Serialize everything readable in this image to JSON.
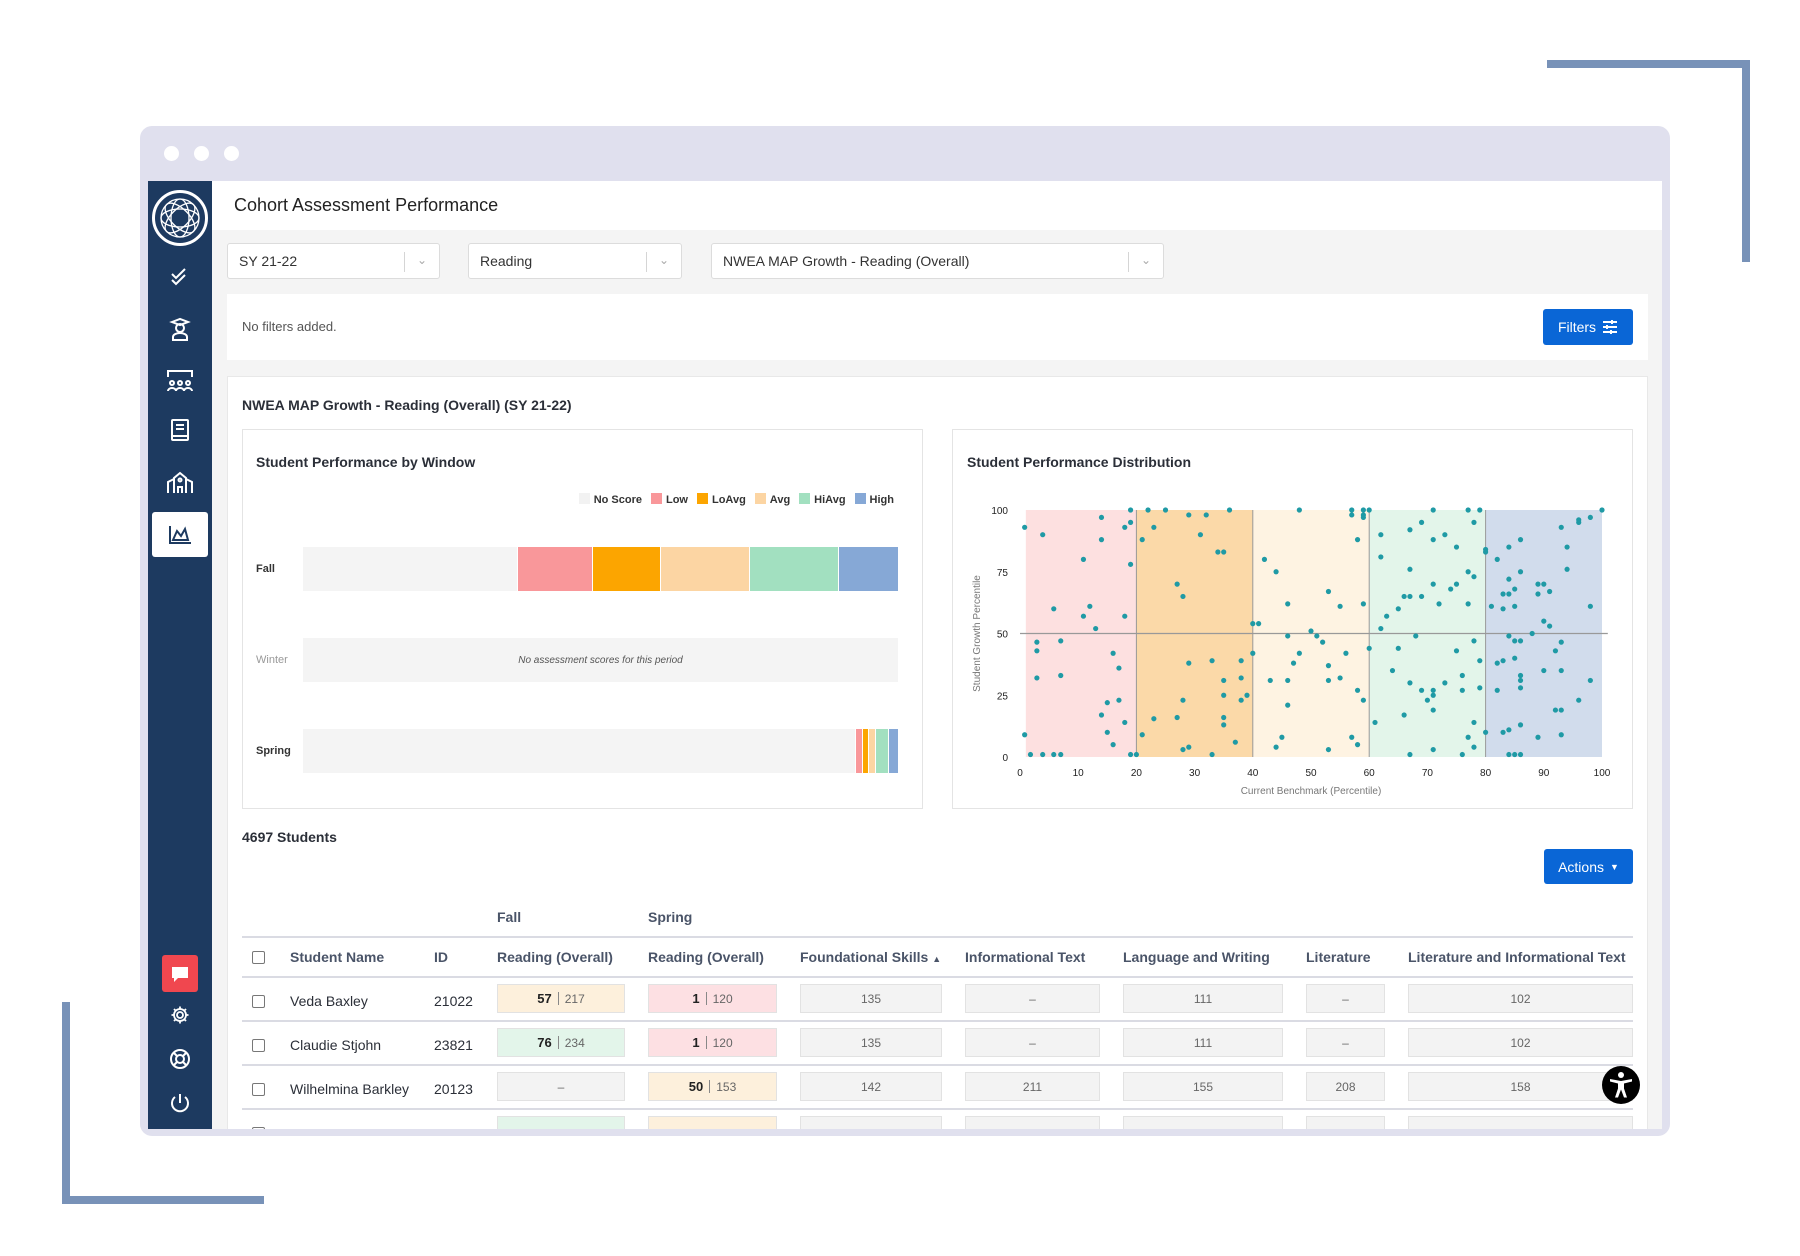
{
  "app": {
    "page_title": "Cohort Assessment Performance"
  },
  "selects": {
    "year": "SY 21-22",
    "subject": "Reading",
    "assessment": "NWEA MAP Growth - Reading (Overall)"
  },
  "filters": {
    "status": "No filters added.",
    "button": "Filters"
  },
  "section_title": "NWEA MAP Growth - Reading (Overall) (SY 21-22)",
  "colors": {
    "sidebar": "#1d3a60",
    "accent": "#0a66d6",
    "chat": "#f0474f",
    "dot": "#1f9aa5"
  },
  "sidebar": {
    "items": [
      {
        "icon": "checklist-icon"
      },
      {
        "icon": "student-icon"
      },
      {
        "icon": "classroom-icon"
      },
      {
        "icon": "book-icon"
      },
      {
        "icon": "school-icon"
      },
      {
        "icon": "chart-icon",
        "active": true
      }
    ],
    "bottom": [
      {
        "icon": "chat-icon"
      },
      {
        "icon": "gear-icon"
      },
      {
        "icon": "lifebuoy-icon"
      },
      {
        "icon": "power-icon"
      }
    ]
  },
  "chart_data": [
    {
      "type": "bar",
      "orientation": "horizontal-stacked",
      "title": "Student Performance by Window",
      "legend": [
        {
          "name": "No Score",
          "color": "#f2f2f2"
        },
        {
          "name": "Low",
          "color": "#f9979a"
        },
        {
          "name": "LoAvg",
          "color": "#fca500"
        },
        {
          "name": "Avg",
          "color": "#fcd5a3"
        },
        {
          "name": "HiAvg",
          "color": "#a2e0c0"
        },
        {
          "name": "High",
          "color": "#86a8d6"
        }
      ],
      "legend_position": "top-right",
      "categories": [
        "Fall",
        "Winter",
        "Spring"
      ],
      "values_percent": [
        [
          36,
          12.5,
          11.5,
          15,
          15,
          10
        ],
        null,
        [
          92.8,
          1.2,
          1.0,
          1.2,
          2.1,
          1.7
        ]
      ],
      "empty_message": "No assessment scores for this period"
    },
    {
      "type": "scatter",
      "title": "Student Performance Distribution",
      "xlabel": "Current Benchmark (Percentile)",
      "ylabel": "Student Growth Percentile",
      "xlim": [
        0,
        100
      ],
      "ylim": [
        0,
        100
      ],
      "xticks": [
        0,
        10,
        20,
        30,
        40,
        50,
        60,
        70,
        80,
        90,
        100
      ],
      "yticks": [
        0,
        25,
        50,
        75,
        100
      ],
      "bands": [
        {
          "from": 1,
          "to": 20,
          "color": "#fde0e0"
        },
        {
          "from": 20,
          "to": 40,
          "color": "#fbd9a8"
        },
        {
          "from": 40,
          "to": 60,
          "color": "#fef3e2"
        },
        {
          "from": 60,
          "to": 80,
          "color": "#e3f5ea"
        },
        {
          "from": 80,
          "to": 100,
          "color": "#d1dcec"
        }
      ],
      "reference_lines": {
        "x": [
          20,
          40,
          60,
          80
        ],
        "y": [
          50
        ]
      },
      "points": [
        [
          0.8,
          93
        ],
        [
          0.8,
          9
        ],
        [
          1.8,
          1
        ],
        [
          2.9,
          46.5
        ],
        [
          2.9,
          43
        ],
        [
          2.9,
          32
        ],
        [
          3.9,
          90
        ],
        [
          3.9,
          1
        ],
        [
          5.8,
          60
        ],
        [
          5.8,
          1
        ],
        [
          7,
          47
        ],
        [
          7,
          33
        ],
        [
          7,
          1
        ],
        [
          10.9,
          80
        ],
        [
          10.9,
          57
        ],
        [
          12,
          61
        ],
        [
          13,
          52
        ],
        [
          14,
          97
        ],
        [
          14,
          88
        ],
        [
          14,
          17
        ],
        [
          15,
          22
        ],
        [
          15,
          10
        ],
        [
          16,
          42
        ],
        [
          16,
          5
        ],
        [
          17,
          36
        ],
        [
          17,
          23
        ],
        [
          18,
          57
        ],
        [
          18,
          93
        ],
        [
          18,
          14
        ],
        [
          19,
          100
        ],
        [
          19,
          95
        ],
        [
          19,
          78
        ],
        [
          19,
          1
        ],
        [
          20,
          1
        ],
        [
          21,
          88
        ],
        [
          21,
          9
        ],
        [
          22,
          100
        ],
        [
          23,
          93
        ],
        [
          23,
          15.5
        ],
        [
          25,
          100
        ],
        [
          27,
          70
        ],
        [
          27,
          16
        ],
        [
          28,
          65
        ],
        [
          28,
          23
        ],
        [
          28,
          3
        ],
        [
          29,
          98
        ],
        [
          29,
          38
        ],
        [
          29,
          4
        ],
        [
          31,
          90
        ],
        [
          32,
          98
        ],
        [
          33,
          1
        ],
        [
          33,
          39
        ],
        [
          34,
          83
        ],
        [
          35,
          83
        ],
        [
          35,
          31
        ],
        [
          35,
          25
        ],
        [
          35,
          16
        ],
        [
          35,
          13
        ],
        [
          36,
          100
        ],
        [
          37,
          6
        ],
        [
          38,
          39
        ],
        [
          38,
          32
        ],
        [
          38,
          23
        ],
        [
          39,
          25
        ],
        [
          40,
          54
        ],
        [
          40,
          42
        ],
        [
          41,
          54
        ],
        [
          42,
          80
        ],
        [
          43,
          31
        ],
        [
          44,
          75
        ],
        [
          44,
          4
        ],
        [
          45,
          8
        ],
        [
          46,
          62
        ],
        [
          46,
          49
        ],
        [
          46,
          31
        ],
        [
          46,
          21
        ],
        [
          47,
          38
        ],
        [
          48,
          100
        ],
        [
          48,
          42
        ],
        [
          50,
          51
        ],
        [
          51,
          49
        ],
        [
          52,
          46.5
        ],
        [
          53,
          67
        ],
        [
          53,
          37
        ],
        [
          53,
          31
        ],
        [
          53,
          3
        ],
        [
          55,
          61
        ],
        [
          55,
          32
        ],
        [
          56,
          42
        ],
        [
          57,
          100
        ],
        [
          57,
          98
        ],
        [
          57,
          8
        ],
        [
          58,
          88
        ],
        [
          58,
          27
        ],
        [
          58,
          5
        ],
        [
          59,
          100
        ],
        [
          59,
          98
        ],
        [
          59,
          97
        ],
        [
          59,
          62
        ],
        [
          59,
          23
        ],
        [
          60,
          100
        ],
        [
          60,
          44
        ],
        [
          61,
          14
        ],
        [
          62,
          90
        ],
        [
          62,
          81
        ],
        [
          62,
          52
        ],
        [
          63,
          57
        ],
        [
          64,
          35
        ],
        [
          65,
          60
        ],
        [
          65,
          44
        ],
        [
          66,
          65
        ],
        [
          66,
          17
        ],
        [
          67,
          92
        ],
        [
          67,
          76
        ],
        [
          67,
          65
        ],
        [
          67,
          30
        ],
        [
          67,
          1
        ],
        [
          68,
          49
        ],
        [
          69,
          95
        ],
        [
          69,
          65
        ],
        [
          69,
          27
        ],
        [
          70,
          23
        ],
        [
          71,
          100
        ],
        [
          71,
          88
        ],
        [
          71,
          70
        ],
        [
          71,
          27
        ],
        [
          71,
          25
        ],
        [
          71,
          19
        ],
        [
          71,
          3
        ],
        [
          72,
          62
        ],
        [
          73,
          90
        ],
        [
          73,
          30
        ],
        [
          74,
          68
        ],
        [
          75,
          85
        ],
        [
          75,
          70
        ],
        [
          75,
          43
        ],
        [
          76,
          33
        ],
        [
          76,
          27
        ],
        [
          76,
          1
        ],
        [
          77,
          100
        ],
        [
          77,
          75
        ],
        [
          77,
          62
        ],
        [
          77,
          8
        ],
        [
          78,
          95
        ],
        [
          78,
          73
        ],
        [
          78,
          47
        ],
        [
          78,
          14
        ],
        [
          78,
          4
        ],
        [
          79,
          100
        ],
        [
          79,
          39
        ],
        [
          79,
          28
        ],
        [
          80,
          84
        ],
        [
          80,
          83
        ],
        [
          80,
          10
        ],
        [
          81,
          61
        ],
        [
          82,
          80
        ],
        [
          82,
          38
        ],
        [
          82,
          27
        ],
        [
          83,
          66
        ],
        [
          83,
          60
        ],
        [
          83,
          39
        ],
        [
          83,
          10
        ],
        [
          84,
          85
        ],
        [
          84,
          72
        ],
        [
          84,
          66
        ],
        [
          84,
          49
        ],
        [
          84,
          11
        ],
        [
          84,
          1
        ],
        [
          85,
          68
        ],
        [
          85,
          61
        ],
        [
          85,
          47
        ],
        [
          85,
          40
        ],
        [
          85,
          1
        ],
        [
          86,
          88
        ],
        [
          86,
          75
        ],
        [
          86,
          47
        ],
        [
          86,
          33
        ],
        [
          86,
          31
        ],
        [
          86,
          28
        ],
        [
          86,
          13
        ],
        [
          86,
          1
        ],
        [
          88,
          50
        ],
        [
          89,
          70
        ],
        [
          89,
          66
        ],
        [
          89,
          8
        ],
        [
          90,
          70
        ],
        [
          90,
          55
        ],
        [
          90,
          35
        ],
        [
          91,
          67
        ],
        [
          91,
          53
        ],
        [
          92,
          43
        ],
        [
          92,
          19
        ],
        [
          93,
          93
        ],
        [
          93,
          46.5
        ],
        [
          93,
          35
        ],
        [
          93,
          19
        ],
        [
          93,
          9
        ],
        [
          94,
          85
        ],
        [
          94,
          76
        ],
        [
          96,
          95
        ],
        [
          96,
          96
        ],
        [
          96,
          23
        ],
        [
          98,
          97
        ],
        [
          98,
          61
        ],
        [
          98,
          31
        ],
        [
          100,
          100
        ]
      ]
    }
  ],
  "students": {
    "count_label": "4697 Students",
    "actions_button": "Actions",
    "group_headers": [
      "Fall",
      "Spring"
    ],
    "columns": [
      "Student Name",
      "ID",
      "Reading (Overall)",
      "Reading (Overall)",
      "Foundational Skills",
      "Informational Text",
      "Language and Writing",
      "Literature",
      "Literature and Informational Text"
    ],
    "sorted_column": "Foundational Skills",
    "sort_direction": "ascending",
    "rows": [
      {
        "name": "Veda Baxley",
        "id": "21022",
        "fall": {
          "pct": "57",
          "score": "217",
          "level": "Avg"
        },
        "spring": {
          "pct": "1",
          "score": "120",
          "level": "Low"
        },
        "foundational": "135",
        "informational": "–",
        "language": "111",
        "literature": "–",
        "lit_info": "102"
      },
      {
        "name": "Claudie Stjohn",
        "id": "23821",
        "fall": {
          "pct": "76",
          "score": "234",
          "level": "HiAvg"
        },
        "spring": {
          "pct": "1",
          "score": "120",
          "level": "Low"
        },
        "foundational": "135",
        "informational": "–",
        "language": "111",
        "literature": "–",
        "lit_info": "102"
      },
      {
        "name": "Wilhelmina Barkley",
        "id": "20123",
        "fall": {
          "dash": "–"
        },
        "spring": {
          "pct": "50",
          "score": "153",
          "level": "Avg"
        },
        "foundational": "142",
        "informational": "211",
        "language": "155",
        "literature": "208",
        "lit_info": "158"
      }
    ]
  }
}
